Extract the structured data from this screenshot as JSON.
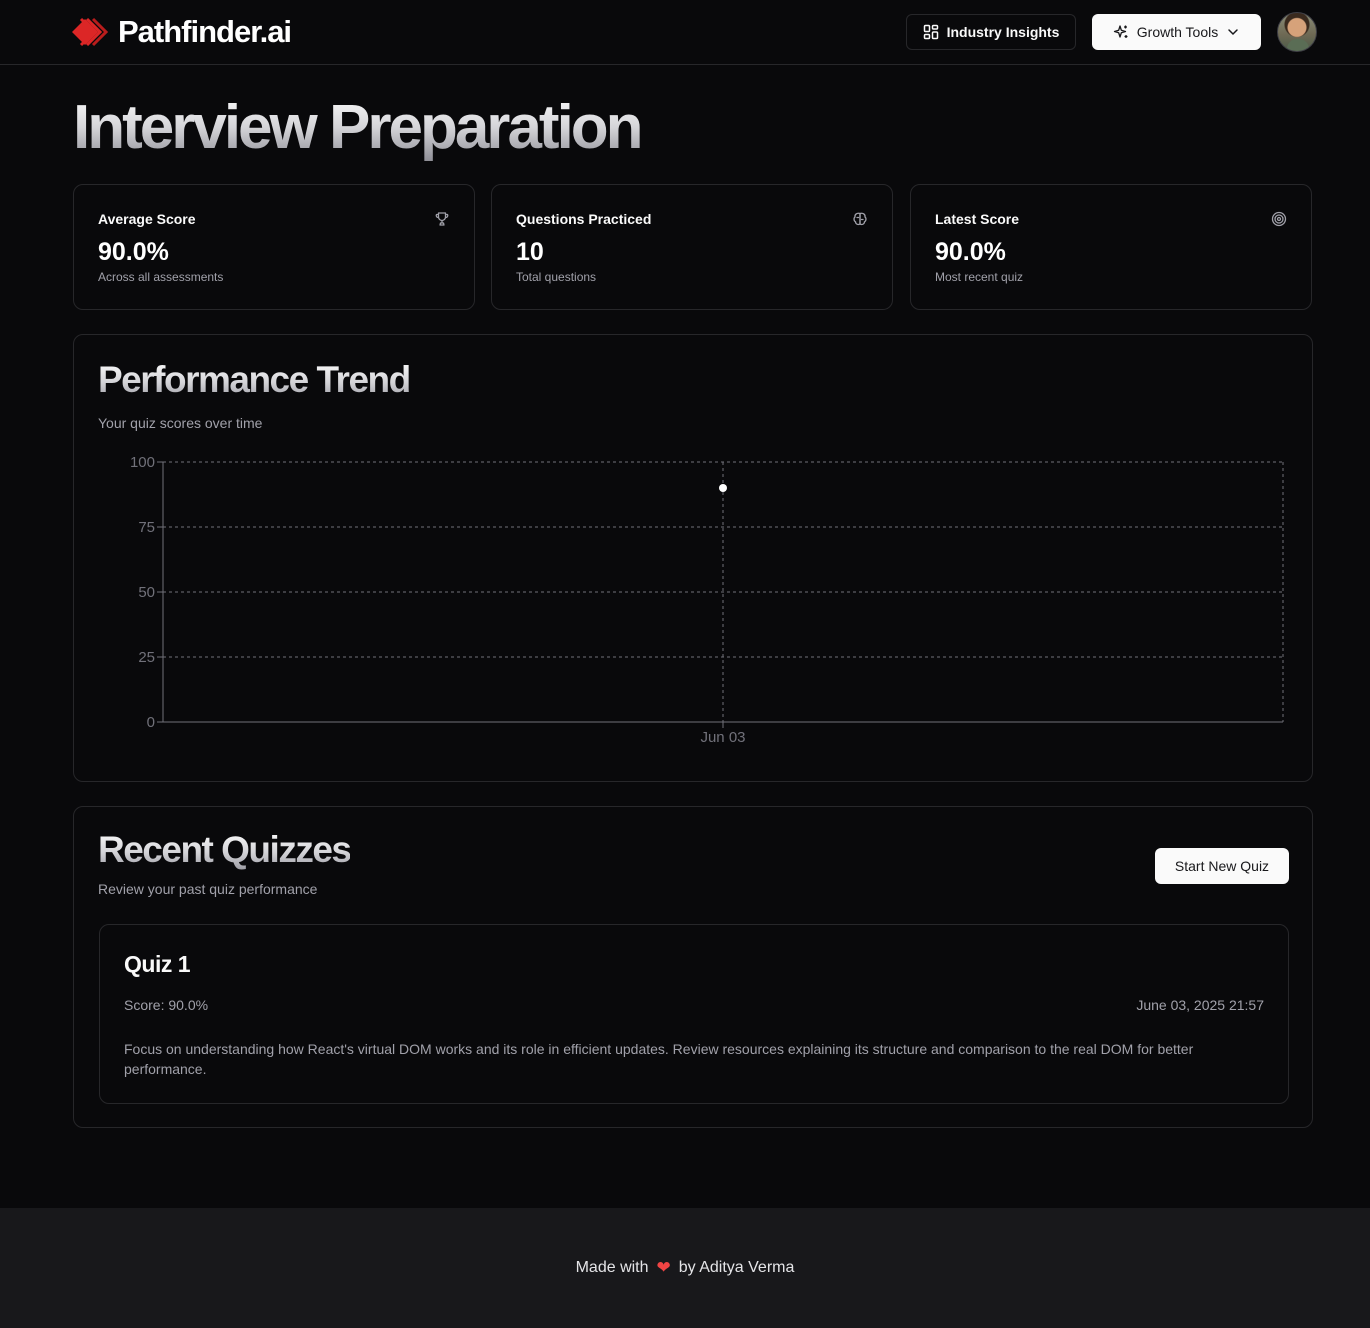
{
  "brand": {
    "name": "Pathfinder.ai",
    "accent": "#dc2626"
  },
  "nav": {
    "industry_insights": "Industry Insights",
    "growth_tools": "Growth Tools"
  },
  "page": {
    "title": "Interview Preparation"
  },
  "stats": [
    {
      "label": "Average Score",
      "value": "90.0%",
      "sub": "Across all assessments",
      "icon": "trophy-icon"
    },
    {
      "label": "Questions Practiced",
      "value": "10",
      "sub": "Total questions",
      "icon": "brain-icon"
    },
    {
      "label": "Latest Score",
      "value": "90.0%",
      "sub": "Most recent quiz",
      "icon": "target-icon"
    }
  ],
  "performance": {
    "title": "Performance Trend",
    "subtitle": "Your quiz scores over time"
  },
  "chart_data": {
    "type": "line",
    "categories": [
      "Jun 03"
    ],
    "series": [
      {
        "values": [
          90
        ]
      }
    ],
    "ylim": [
      0,
      100
    ],
    "yticks": [
      0,
      25,
      50,
      75,
      100
    ],
    "grid": true,
    "line_color": "#ffffff"
  },
  "quizzes": {
    "title": "Recent Quizzes",
    "subtitle": "Review your past quiz performance",
    "start_button": "Start New Quiz",
    "items": [
      {
        "title": "Quiz 1",
        "score": "Score: 90.0%",
        "date": "June 03, 2025 21:57",
        "feedback": "Focus on understanding how React's virtual DOM works and its role in efficient updates. Review resources explaining its structure and comparison to the real DOM for better performance."
      }
    ]
  },
  "footer": {
    "prefix": "Made with",
    "suffix": "by Aditya Verma",
    "heart": "❤"
  }
}
